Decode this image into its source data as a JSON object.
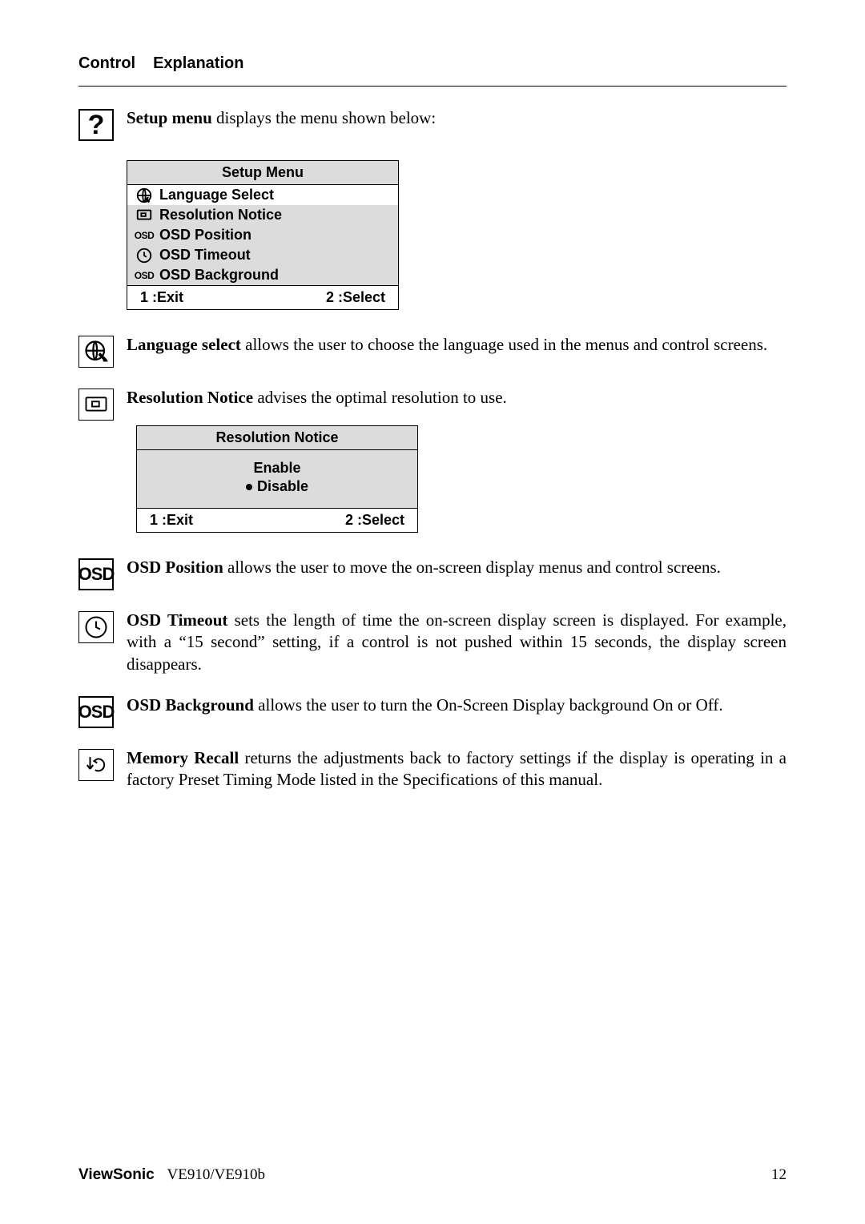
{
  "header": {
    "control": "Control",
    "explanation": "Explanation"
  },
  "setup_menu": {
    "intro_bold": "Setup menu",
    "intro_rest": " displays the menu shown below:",
    "title": "Setup Menu",
    "items": {
      "language": "Language Select",
      "resolution": "Resolution Notice",
      "position": "OSD Position",
      "timeout": "OSD Timeout",
      "background": "OSD Background"
    },
    "footer_exit": "1 :Exit",
    "footer_select": "2 :Select"
  },
  "language": {
    "bold": "Language select",
    "text": " allows the user to choose the language used in the menus and control screens."
  },
  "resolution": {
    "bold": "Resolution Notice",
    "text": " advises the optimal resolution to use.",
    "title": "Resolution Notice",
    "enable": "Enable",
    "disable": "Disable",
    "footer_exit": "1 :Exit",
    "footer_select": "2 :Select"
  },
  "osd_position": {
    "bold": "OSD Position",
    "text": " allows the user to move the on-screen display menus and control screens."
  },
  "osd_timeout": {
    "bold": "OSD Timeout",
    "text": " sets the length of time the on-screen display screen is displayed. For example, with a “15 second” setting, if a control is not pushed within 15 seconds, the display screen disappears."
  },
  "osd_background": {
    "bold": "OSD Background",
    "text": " allows the user to turn the On-Screen Display background On or Off."
  },
  "memory_recall": {
    "bold": "Memory Recall",
    "text": " returns the adjustments back to factory settings if the display is operating in a factory Preset Timing Mode listed in the Specifications of this manual."
  },
  "footer": {
    "brand": "ViewSonic",
    "model": "VE910/VE910b",
    "page": "12"
  }
}
